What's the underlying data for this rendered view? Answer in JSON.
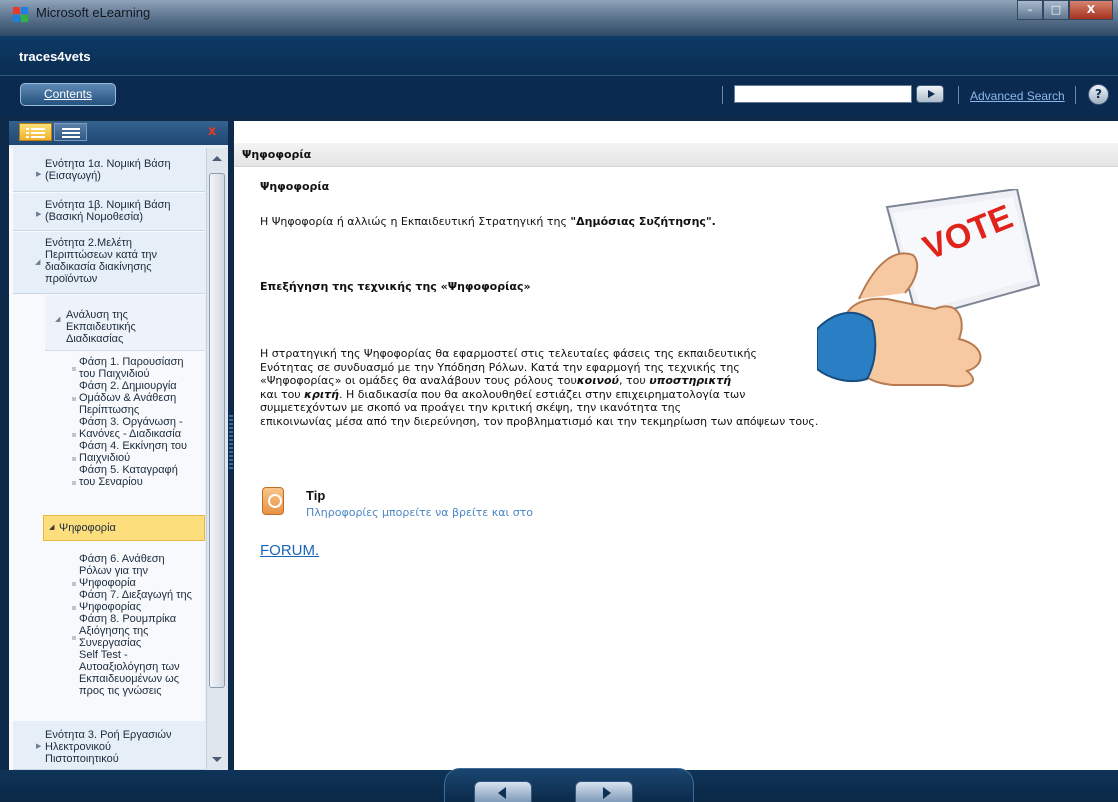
{
  "window": {
    "title": "Microsoft eLearning",
    "minimize_label": "–",
    "maximize_label": "□",
    "close_label": "X"
  },
  "header": {
    "title": "traces4vets"
  },
  "toolbar": {
    "contents_label": "Contents",
    "search_value": "",
    "advanced_search_label": "Advanced Search",
    "help_label": "?"
  },
  "sidebar": {
    "close_label": "x",
    "items": [
      {
        "label_lines": [
          "Ενότητα 1α. Νομική Βάση",
          "(Εισαγωγή)"
        ]
      },
      {
        "label_lines": [
          "Ενότητα 1β. Νομική Βάση",
          "(Βασική Νομοθεσία)"
        ]
      },
      {
        "label_lines": [
          "Ενότητα 2.Μελέτη",
          "Περιπτώσεων κατά την",
          "διαδικασία διακίνησης",
          "προϊόντων"
        ]
      },
      {
        "label_lines": [
          "Ανάλυση της",
          "Εκπαιδευτικής",
          "Διαδικασίας"
        ]
      },
      {
        "label_lines": [
          "Φάση 1. Παρουσίαση",
          "του Παιχνιδιού"
        ]
      },
      {
        "label_lines": [
          "Φάση 2. Δημιουργία",
          "Ομάδων & Ανάθεση",
          "Περίπτωσης"
        ]
      },
      {
        "label_lines": [
          "Φάση 3. Οργάνωση -",
          "Κανόνες - Διαδικασία"
        ]
      },
      {
        "label_lines": [
          "Φάση 4. Εκκίνηση του",
          "Παιχνιδιού"
        ]
      },
      {
        "label_lines": [
          "Φάση 5. Καταγραφή",
          "του Σεναρίου"
        ]
      },
      {
        "label_lines": [
          "Ψηφοφορία"
        ]
      },
      {
        "label_lines": [
          "Φάση 6. Ανάθεση",
          "Ρόλων για την",
          "Ψηφοφορία"
        ]
      },
      {
        "label_lines": [
          "Φάση 7. Διεξαγωγή της",
          "Ψηφοφορίας"
        ]
      },
      {
        "label_lines": [
          "Φάση 8. Ρουμπρίκα",
          "Αξιόγησης της",
          "Συνεργασίας"
        ]
      },
      {
        "label_lines": [
          "Self Test -",
          "Αυτοαξιολόγηση των",
          "Εκπαιδευομένων ως",
          "προς τις γνώσεις"
        ]
      },
      {
        "label_lines": [
          "Ενότητα 3. Ροή Εργασιών",
          "Ηλεκτρονικού",
          "Πιστοποιητικού"
        ]
      }
    ]
  },
  "content": {
    "header": "Ψηφοφορία",
    "title": "Ψηφοφορία",
    "intro_text": "Η Ψηφοφορία ή αλλιώς η Εκπαιδευτική Στρατηγική της ",
    "intro_bold": "\"Δημόσιας Συζήτησης\".",
    "subtitle": "Επεξήγηση της τεχνικής της «Ψηφοφορίας»",
    "para_lines": [
      "Η στρατηγική της Ψηφοφορίας θα εφαρμοστεί στις τελευταίες φάσεις της εκπαιδευτικής",
      "Ενότητας σε συνδυασμό με την Υπόδηση Ρόλων. Κατά την εφαρμογή της τεχνικής  της",
      "«Ψηφοφορίας» οι ομάδες θα αναλάβουν τους ρόλους του",
      "κοινού",
      ", του ",
      "υποστηρικτή",
      "και του ",
      "κριτή",
      ". Η διαδικασία που θα ακολουθηθεί εστιάζει στην επιχειρηματολογία των",
      "συμμετεχόντων με σκοπό να προάγει την κριτική σκέψη, την ικανότητα της",
      "επικοινωνίας μέσα από την διερεύνηση, τον προβληματισμό και την τεκμηρίωση των απόψεων τους."
    ],
    "image_text": "VOTE",
    "tip_title": "Tip",
    "tip_text": "Πληροφορίες μπορείτε να βρείτε και στο",
    "forum_label": "FORUM."
  },
  "colors": {
    "accent": "#0a2b4f",
    "selected": "#fdde7d",
    "link": "#1a66b8"
  }
}
